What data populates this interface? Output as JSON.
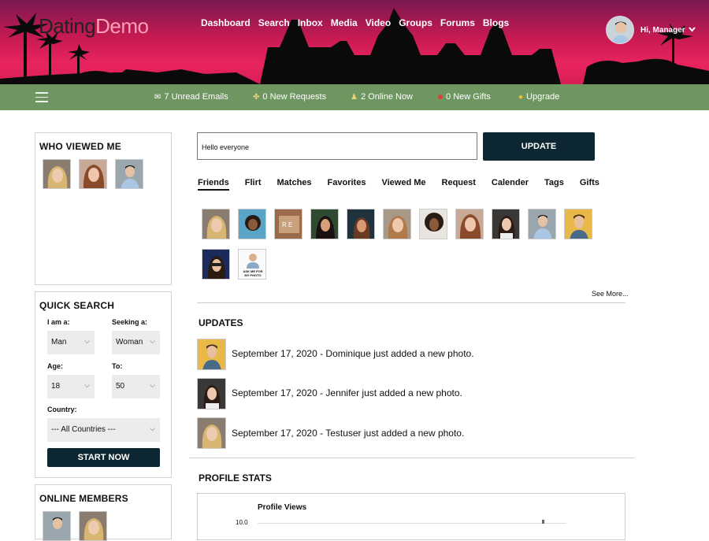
{
  "brand": {
    "part1": "Dating",
    "part2": "Demo"
  },
  "topnav": [
    "Dashboard",
    "Search",
    "Inbox",
    "Media",
    "Video",
    "Groups",
    "Forums",
    "Blogs"
  ],
  "user": {
    "greeting": "Hi, Manager"
  },
  "subbar": {
    "emails": "7 Unread Emails",
    "requests": "0 New Requests",
    "online": "2 Online Now",
    "gifts": "0 New Gifts",
    "upgrade": "Upgrade"
  },
  "who_viewed": {
    "title": "WHO VIEWED ME"
  },
  "quick_search": {
    "title": "QUICK SEARCH",
    "i_am_label": "I am a:",
    "i_am_value": "Man",
    "seeking_label": "Seeking a:",
    "seeking_value": "Woman",
    "age_label": "Age:",
    "age_value": "18",
    "to_label": "To:",
    "to_value": "50",
    "country_label": "Country:",
    "country_value": "--- All Countries ---",
    "start_button": "START NOW"
  },
  "online_members": {
    "title": "ONLINE MEMBERS"
  },
  "status": {
    "value": "Hello everyone",
    "button": "UPDATE"
  },
  "tabs": [
    "Friends",
    "Flirt",
    "Matches",
    "Favorites",
    "Viewed Me",
    "Request",
    "Calender",
    "Tags",
    "Gifts"
  ],
  "friends": {
    "placeholder_text": "ASK ME FOR MY PHOTO",
    "see_more": "See More..."
  },
  "updates": {
    "title": "UPDATES",
    "items": [
      "September 17, 2020 - Dominique  just added a new photo.",
      "September 17, 2020 - Jennifer  just added a new photo.",
      "September 17, 2020 - Testuser  just added a new photo."
    ]
  },
  "profile_stats": {
    "title": "PROFILE STATS",
    "chart_data": {
      "type": "line",
      "title": "Profile Views",
      "ylim_top_label": "10.0"
    }
  }
}
